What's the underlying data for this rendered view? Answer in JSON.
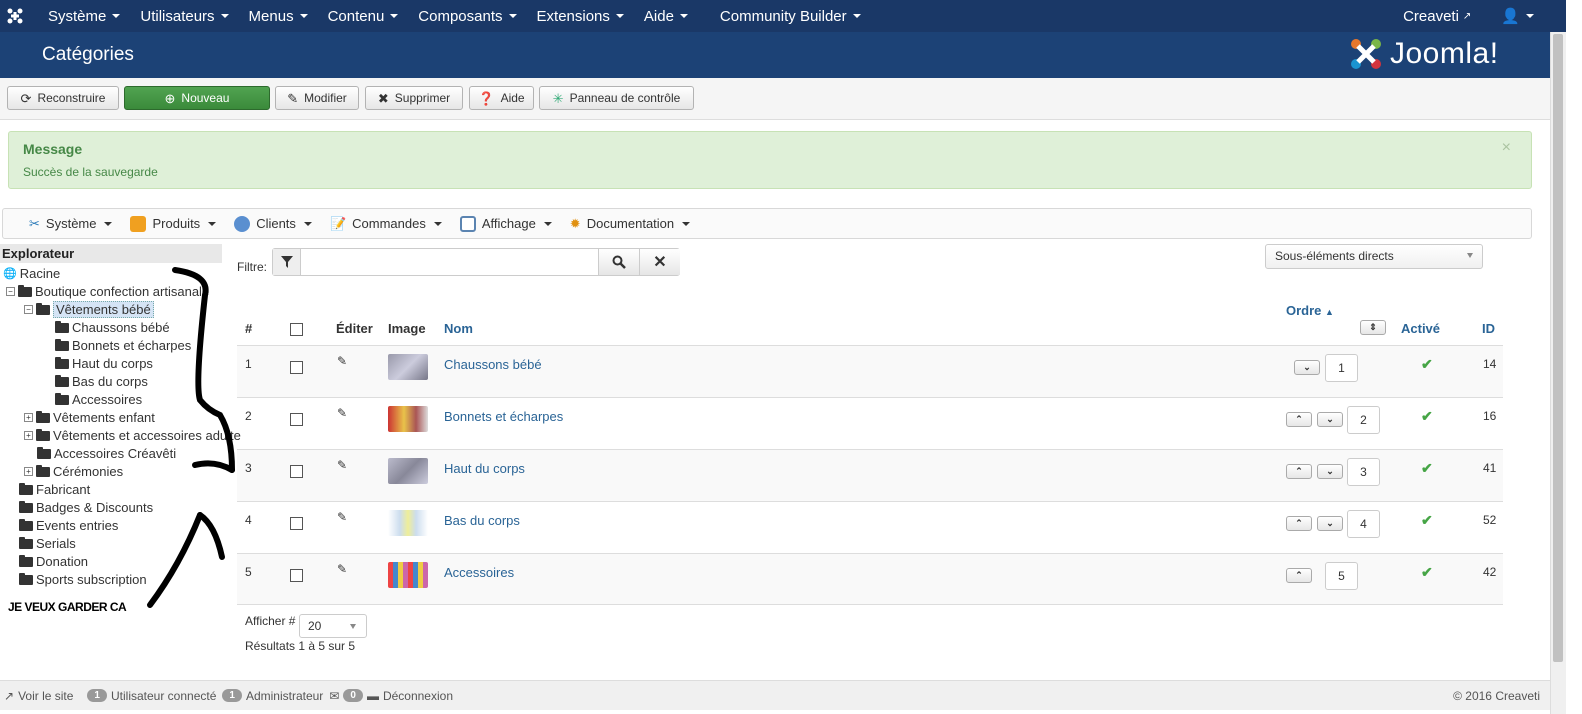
{
  "topnav": {
    "menus": [
      "Système",
      "Utilisateurs",
      "Menus",
      "Contenu",
      "Composants",
      "Extensions",
      "Aide",
      "Community Builder"
    ],
    "site_name": "Creaveti"
  },
  "header": {
    "title": "Catégories",
    "brand": "Joomla!"
  },
  "toolbar": {
    "rebuild": "Reconstruire",
    "new": "Nouveau",
    "edit": "Modifier",
    "delete": "Supprimer",
    "help": "Aide",
    "control_panel": "Panneau de contrôle"
  },
  "message": {
    "heading": "Message",
    "text": "Succès de la sauvegarde",
    "close": "×"
  },
  "vm_menu": [
    "Système",
    "Produits",
    "Clients",
    "Commandes",
    "Affichage",
    "Documentation"
  ],
  "tree": {
    "header": "Explorateur",
    "nodes": [
      "Racine",
      "Boutique confection artisanale",
      "Vêtements bébé",
      "Chaussons bébé",
      "Bonnets et écharpes",
      "Haut du corps",
      "Bas du corps",
      "Accessoires",
      "Vêtements enfant",
      "Vêtements et accessoires adulte",
      "Accessoires Créavêti",
      "Cérémonies",
      "Fabricant",
      "Badges & Discounts",
      "Events entries",
      "Serials",
      "Donation",
      "Sports subscription"
    ]
  },
  "filter": {
    "label": "Filtre:",
    "placeholder": ""
  },
  "scope_select": "Sous-éléments directs",
  "table": {
    "headers": {
      "num": "#",
      "edit": "Éditer",
      "image": "Image",
      "name": "Nom",
      "order": "Ordre",
      "active": "Activé",
      "id": "ID"
    },
    "rows": [
      {
        "num": "1",
        "name": "Chaussons bébé",
        "order": "1",
        "id": "14"
      },
      {
        "num": "2",
        "name": "Bonnets et écharpes",
        "order": "2",
        "id": "16"
      },
      {
        "num": "3",
        "name": "Haut du corps",
        "order": "3",
        "id": "41"
      },
      {
        "num": "4",
        "name": "Bas du corps",
        "order": "4",
        "id": "52"
      },
      {
        "num": "5",
        "name": "Accessoires",
        "order": "5",
        "id": "42"
      }
    ]
  },
  "list_footer": {
    "show_label": "Afficher #",
    "limit": "20",
    "results": "Résultats 1 à 5 sur 5"
  },
  "annotation": "JE VEUX GARDER CA",
  "status": {
    "view_site": "Voir le site",
    "users_count": "1",
    "users_label": "Utilisateur connecté",
    "admins_count": "1",
    "admins_label": "Administrateur",
    "msgs_count": "0",
    "logout": "Déconnexion",
    "copyright": "© 2016 Creaveti"
  },
  "colors": {
    "nav": "#1a3867",
    "header": "#1c4276",
    "success_bg": "#dff0d8",
    "link": "#2a6496",
    "check": "#46a546"
  }
}
